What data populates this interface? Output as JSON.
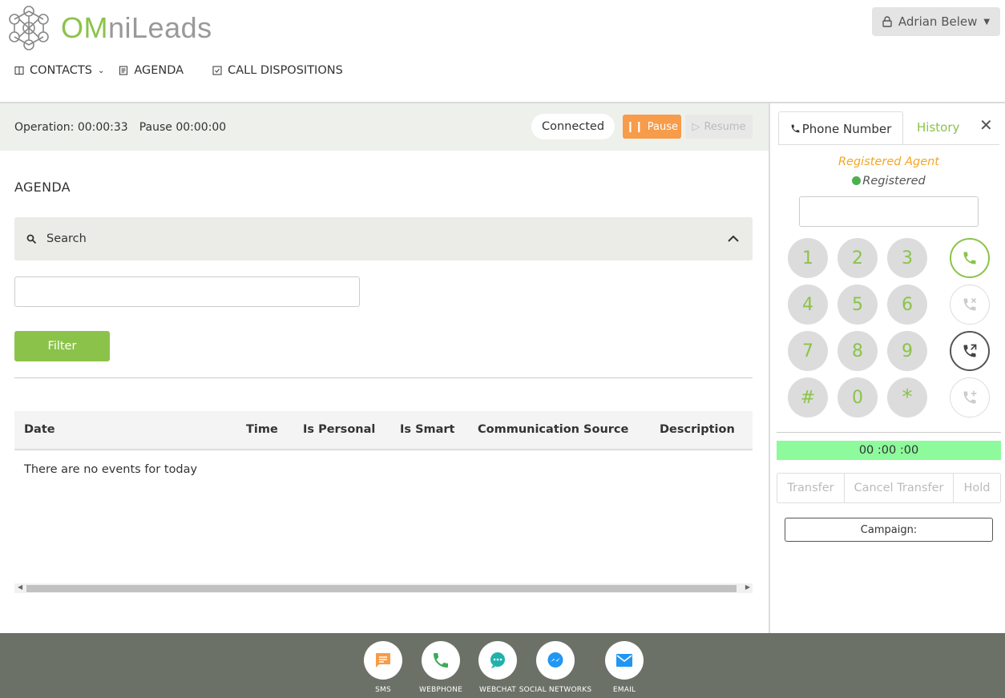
{
  "header": {
    "logo_text_a": "OM",
    "logo_text_b": "niLeads",
    "user_name": "Adrian Belew"
  },
  "nav": {
    "contacts": "CONTACTS",
    "agenda": "AGENDA",
    "dispositions": "CALL DISPOSITIONS"
  },
  "status": {
    "operation": "Operation: 00:00:33",
    "pause_time": "Pause 00:00:00",
    "connection": "Connected",
    "pause_label": "Pause",
    "resume_label": "Resume"
  },
  "main": {
    "title": "AGENDA",
    "search_label": "Search",
    "search_value": "",
    "filter_label": "Filter",
    "columns": [
      "Date",
      "Time",
      "Is Personal",
      "Is Smart",
      "Communication Source",
      "Description"
    ],
    "empty_message": "There are no events for today"
  },
  "phone": {
    "tab_phone": "Phone Number",
    "tab_history": "History",
    "close": "✕",
    "agent_label": "Registered Agent",
    "registration_status": "Registered",
    "number_value": "",
    "keys": [
      "1",
      "2",
      "3",
      "4",
      "5",
      "6",
      "7",
      "8",
      "9",
      "#",
      "0",
      "*"
    ],
    "timer": "00 :00 :00",
    "transfer": "Transfer",
    "cancel_transfer": "Cancel Transfer",
    "hold": "Hold",
    "campaign": "Campaign:"
  },
  "footer": {
    "sms": "SMS",
    "webphone": "WEBPHONE",
    "webchat": "WEBCHAT",
    "social": "SOCIAL NETWORKS",
    "email": "EMAIL"
  },
  "colors": {
    "brand_green": "#8bc34a",
    "pause_orange": "#f79c4a",
    "timer_green": "#8dfa9c",
    "footer_bg": "#6c7168"
  }
}
